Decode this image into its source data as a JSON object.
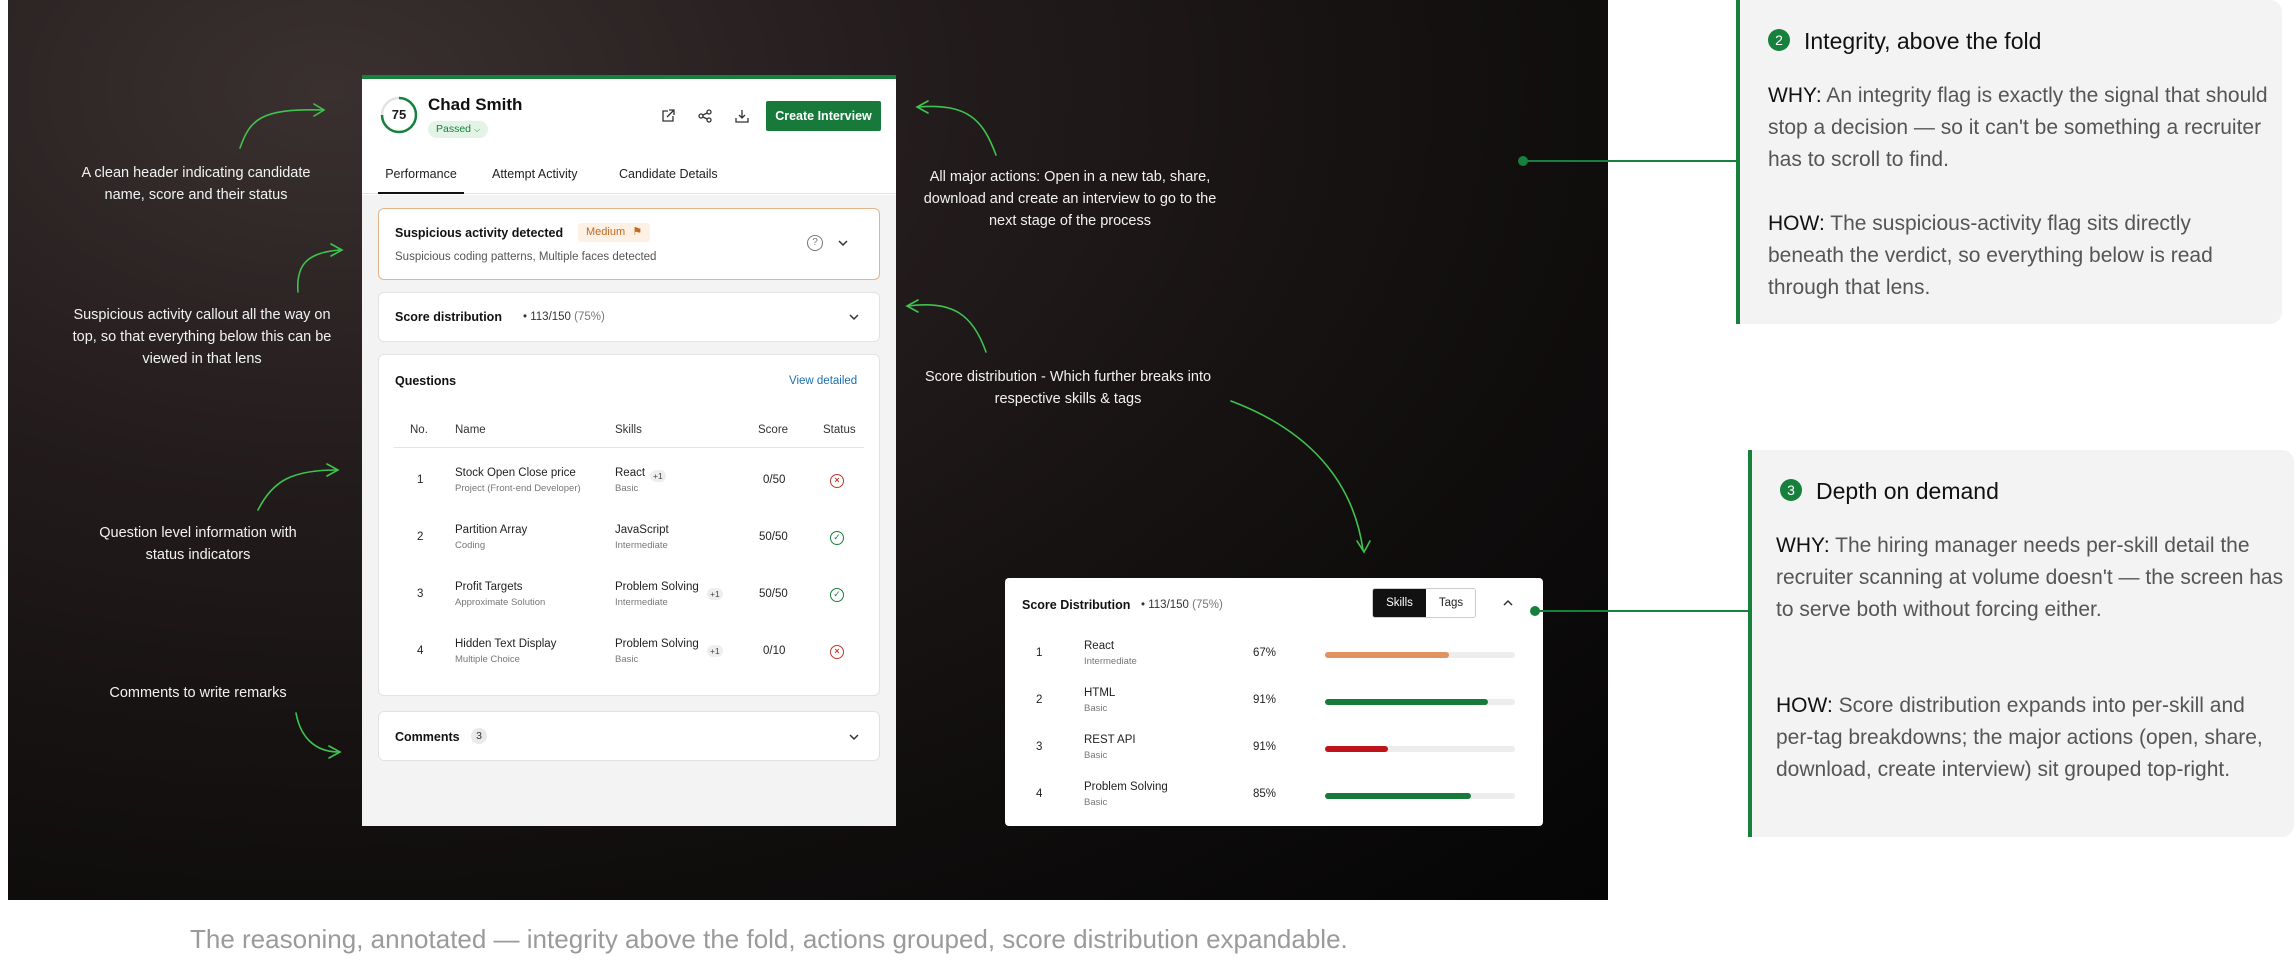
{
  "annotations": {
    "header": "A clean header indicating candidate name, score and their status",
    "suspicious": "Suspicious activity callout all the way on top, so that everything below this can be viewed in that lens",
    "questions": "Question level information with status indicators",
    "comments": "Comments to write remarks",
    "actions": "All major actions: Open in a new tab, share, download and create an interview to go to the next stage of the process",
    "score_distribution": "Score distribution - Which further breaks into respective skills & tags"
  },
  "candidate": {
    "score": "75",
    "name": "Chad Smith",
    "status": "Passed",
    "status_chevron": "chevron-down-icon",
    "create_button": "Create Interview",
    "header_icons": [
      "external-link-icon",
      "share-icon",
      "download-icon"
    ]
  },
  "tabs": [
    "Performance",
    "Attempt Activity",
    "Candidate Details"
  ],
  "suspicious": {
    "title": "Suspicious activity detected",
    "severity": "Medium",
    "description": "Suspicious coding patterns, Multiple faces detected",
    "help_icon": "?"
  },
  "score_distribution": {
    "title": "Score distribution",
    "value": "113/150",
    "percent": "(75%)"
  },
  "questions": {
    "title": "Questions",
    "view_detailed": "View detailed",
    "headers": [
      "No.",
      "Name",
      "Skills",
      "Score",
      "Status"
    ],
    "rows": [
      {
        "no": "1",
        "name": "Stock Open Close price",
        "type": "Project (Front-end Developer)",
        "skill": "React",
        "level": "Basic",
        "extra": "+1",
        "score": "0/50",
        "status": "failed",
        "icon": "×"
      },
      {
        "no": "2",
        "name": "Partition Array",
        "type": "Coding",
        "skill": "JavaScript",
        "level": "Intermediate",
        "extra": "",
        "score": "50/50",
        "status": "passed",
        "icon": "✓"
      },
      {
        "no": "3",
        "name": "Profit Targets",
        "type": "Approximate Solution",
        "skill": "Problem Solving",
        "level": "Intermediate",
        "extra": "+1",
        "score": "50/50",
        "status": "passed",
        "icon": "✓"
      },
      {
        "no": "4",
        "name": "Hidden Text Display",
        "type": "Multiple Choice",
        "skill": "Problem Solving",
        "level": "Basic",
        "extra": "+1",
        "score": "0/10",
        "status": "failed",
        "icon": "×"
      }
    ]
  },
  "comments": {
    "title": "Comments",
    "count": "3"
  },
  "sd_expanded": {
    "title": "Score Distribution",
    "value": "113/150",
    "percent": "(75%)",
    "toggle": [
      "Skills",
      "Tags"
    ],
    "active_toggle": "Skills",
    "rows": [
      {
        "no": "1",
        "skill": "React",
        "level": "Intermediate",
        "pct": "67%",
        "fill": 0.65,
        "color": "#e0925f"
      },
      {
        "no": "2",
        "skill": "HTML",
        "level": "Basic",
        "pct": "91%",
        "fill": 0.86,
        "color": "#177a3a"
      },
      {
        "no": "3",
        "skill": "REST API",
        "level": "Basic",
        "pct": "91%",
        "fill": 0.33,
        "color": "#c0141c"
      },
      {
        "no": "4",
        "skill": "Problem Solving",
        "level": "Basic",
        "pct": "85%",
        "fill": 0.77,
        "color": "#177a3a"
      }
    ]
  },
  "notes": [
    {
      "num": "2",
      "title": "Integrity, above the fold",
      "why_label": "WHY:",
      "why": "An integrity flag is exactly the signal that should stop a decision — so it can't be something a recruiter has to scroll to find.",
      "how_label": "HOW:",
      "how": "The suspicious-activity flag sits directly beneath the verdict, so everything below is read through that lens."
    },
    {
      "num": "3",
      "title": "Depth on demand",
      "why_label": "WHY:",
      "why": "The hiring manager needs per-skill detail the recruiter scanning at volume doesn't — the screen has to serve both without forcing either.",
      "how_label": "HOW:",
      "how": "Score distribution expands into per-skill and per-tag breakdowns; the major actions (open, share, download, create interview) sit grouped top-right."
    }
  ],
  "caption": "The reasoning, annotated — integrity above the fold, actions grouped, score distribution expandable.",
  "colors": {
    "accent_green": "#17803d",
    "warning_orange": "#e3b48c",
    "fail_red": "#c0392b"
  }
}
